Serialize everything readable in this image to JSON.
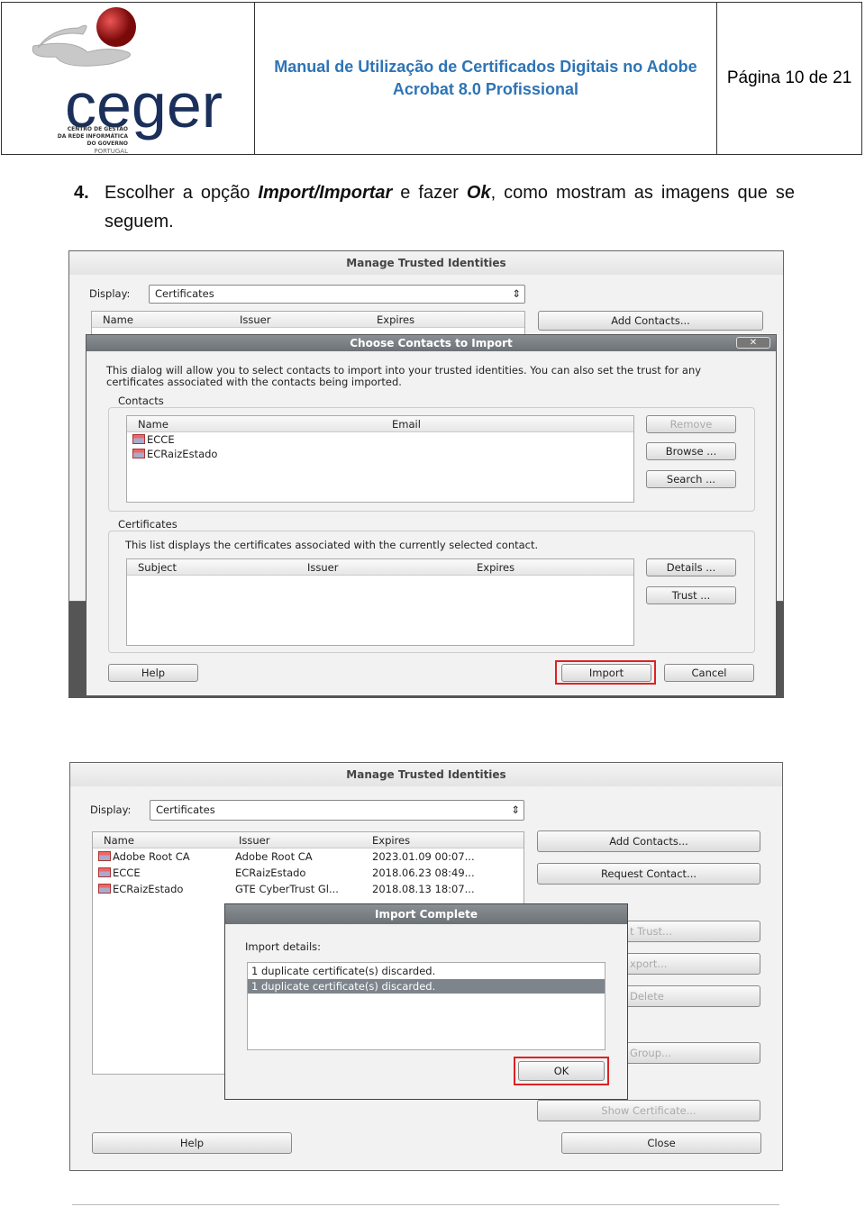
{
  "header": {
    "logo_text": "ceger",
    "logo_subtitle": "CENTRO DE GESTÃO DA REDE INFORMÁTICA DO GOVERNO",
    "logo_country": "PORTUGAL",
    "title": "Manual de Utilização de Certificados Digitais no Adobe Acrobat 8.0 Profissional",
    "page": "Página 10 de 21"
  },
  "step": {
    "number": "4.",
    "text_before": "Escolher a opção ",
    "bold1": "Import/Importar",
    "text_mid": " e fazer ",
    "bold2": "Ok",
    "text_after": ", como mostram as imagens que se seguem."
  },
  "shot1": {
    "window_title": "Manage Trusted Identities",
    "display_label": "Display:",
    "display_value": "Certificates",
    "columns": [
      "Name",
      "Issuer",
      "Expires"
    ],
    "add_contacts": "Add Contacts...",
    "dialog": {
      "title": "Choose Contacts to Import",
      "description": "This dialog will allow you to select contacts to import into your trusted identities. You can also set the trust for any certificates associated with the contacts being imported.",
      "contacts_label": "Contacts",
      "contacts_columns": [
        "Name",
        "Email"
      ],
      "contacts": [
        "ECCE",
        "ECRaizEstado"
      ],
      "remove": "Remove",
      "browse": "Browse ...",
      "search": "Search ...",
      "certificates_label": "Certificates",
      "certificates_desc": "This list displays the certificates associated with the currently selected contact.",
      "cert_columns": [
        "Subject",
        "Issuer",
        "Expires"
      ],
      "details": "Details ...",
      "trust": "Trust ...",
      "help": "Help",
      "import": "Import",
      "cancel": "Cancel"
    }
  },
  "shot2": {
    "window_title": "Manage Trusted Identities",
    "display_label": "Display:",
    "display_value": "Certificates",
    "columns": [
      "Name",
      "Issuer",
      "Expires"
    ],
    "rows": [
      {
        "name": "Adobe Root CA",
        "issuer": "Adobe Root CA",
        "expires": "2023.01.09 00:07..."
      },
      {
        "name": "ECCE",
        "issuer": "ECRaizEstado",
        "expires": "2018.06.23 08:49..."
      },
      {
        "name": "ECRaizEstado",
        "issuer": "GTE CyberTrust Gl...",
        "expires": "2018.08.13 18:07..."
      }
    ],
    "buttons": [
      "Add Contacts...",
      "Request Contact...",
      "t Trust...",
      "xport...",
      "Delete",
      "Group...",
      "Show Certificate..."
    ],
    "help": "Help",
    "close": "Close",
    "dialog": {
      "title": "Import Complete",
      "details_label": "Import details:",
      "lines": [
        "1 duplicate certificate(s) discarded.",
        "1 duplicate certificate(s) discarded."
      ],
      "ok": "OK"
    }
  }
}
